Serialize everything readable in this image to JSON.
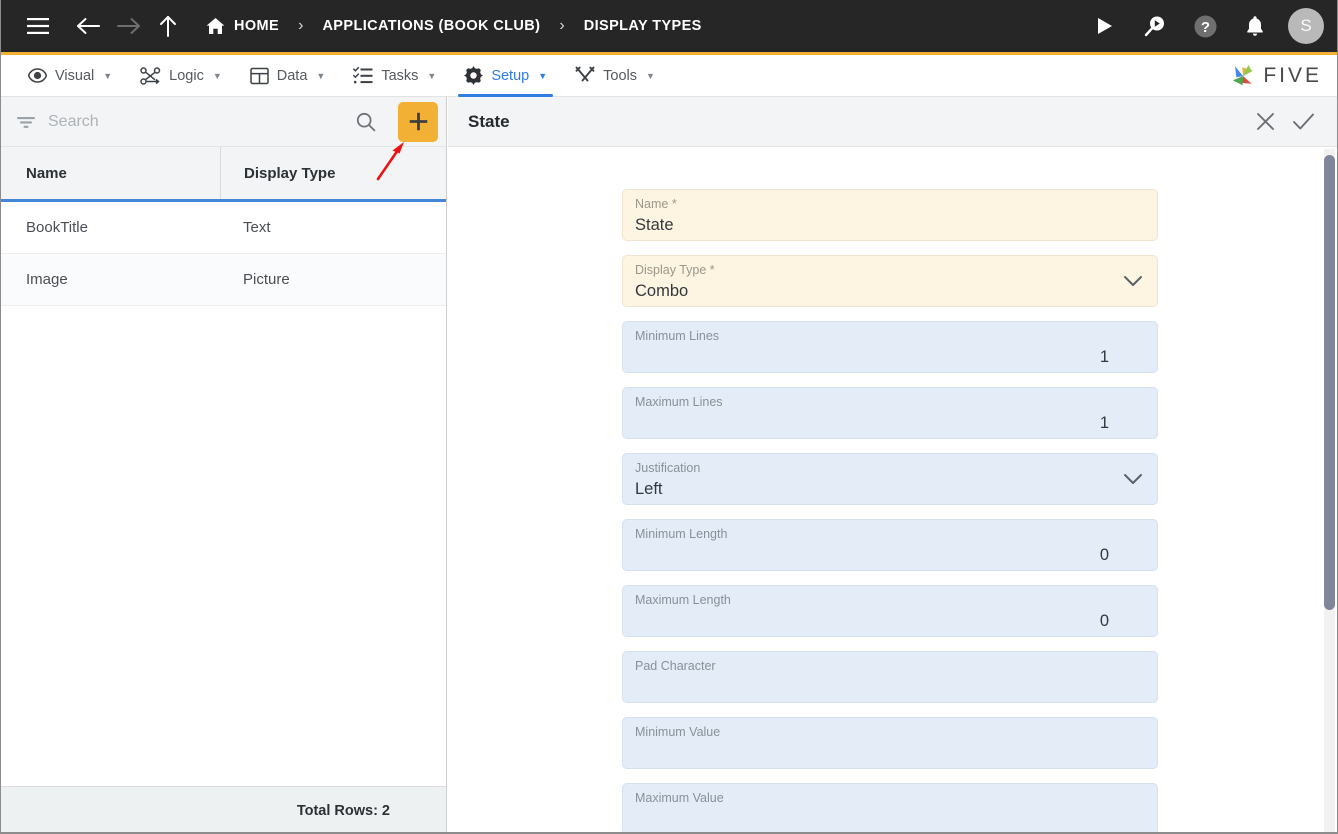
{
  "topbar": {
    "icons": {
      "menu": "hamburger-menu-icon",
      "back": "back-arrow-icon",
      "forward": "forward-arrow-icon",
      "up": "up-arrow-icon"
    },
    "breadcrumbs": [
      {
        "label": "HOME",
        "icon": "home-icon"
      },
      {
        "label": "APPLICATIONS (BOOK CLUB)",
        "icon": ""
      },
      {
        "label": "DISPLAY TYPES",
        "icon": ""
      }
    ],
    "separator": "›",
    "actions": [
      {
        "name": "run-play-button",
        "icon": "play-icon"
      },
      {
        "name": "video-search-button",
        "icon": "video-search-icon"
      },
      {
        "name": "help-button",
        "icon": "help-circle-icon"
      },
      {
        "name": "notifications-button",
        "icon": "bell-icon"
      }
    ],
    "avatar_initial": "S"
  },
  "menubar": {
    "items": [
      {
        "label": "Visual",
        "icon": "eye-icon",
        "active": false
      },
      {
        "label": "Logic",
        "icon": "node-graph-icon",
        "active": false
      },
      {
        "label": "Data",
        "icon": "table-grid-icon",
        "active": false
      },
      {
        "label": "Tasks",
        "icon": "checklist-icon",
        "active": false
      },
      {
        "label": "Setup",
        "icon": "gear-icon",
        "active": true
      },
      {
        "label": "Tools",
        "icon": "wrench-screwdriver-icon",
        "active": false
      }
    ],
    "caret": "▼",
    "logo_text": "FIVE"
  },
  "left_panel": {
    "search": {
      "placeholder": "Search",
      "value": "",
      "filter_icon": "filter-funnel-icon",
      "search_icon": "magnifier-icon"
    },
    "add_button": {
      "label": "+",
      "color": "#F2B134"
    },
    "table": {
      "columns": [
        "Name",
        "Display Type"
      ],
      "rows": [
        {
          "name": "BookTitle",
          "display_type": "Text"
        },
        {
          "name": "Image",
          "display_type": "Picture"
        }
      ]
    },
    "footer": "Total Rows: 2"
  },
  "detail_panel": {
    "title": "State",
    "close_icon": "close-x-icon",
    "confirm_icon": "checkmark-icon",
    "fields": [
      {
        "label": "Name *",
        "value": "State",
        "kind": "required",
        "align": "left",
        "chevron": false
      },
      {
        "label": "Display Type *",
        "value": "Combo",
        "kind": "required",
        "align": "left",
        "chevron": true
      },
      {
        "label": "Minimum Lines",
        "value": "1",
        "kind": "normal",
        "align": "right",
        "chevron": false
      },
      {
        "label": "Maximum Lines",
        "value": "1",
        "kind": "normal",
        "align": "right",
        "chevron": false
      },
      {
        "label": "Justification",
        "value": "Left",
        "kind": "normal",
        "align": "left",
        "chevron": true
      },
      {
        "label": "Minimum Length",
        "value": "0",
        "kind": "normal",
        "align": "right",
        "chevron": false
      },
      {
        "label": "Maximum Length",
        "value": "0",
        "kind": "normal",
        "align": "right",
        "chevron": false
      },
      {
        "label": "Pad Character",
        "value": "",
        "kind": "normal",
        "align": "left",
        "chevron": false
      },
      {
        "label": "Minimum Value",
        "value": "",
        "kind": "normal",
        "align": "left",
        "chevron": false
      },
      {
        "label": "Maximum Value",
        "value": "",
        "kind": "normal",
        "align": "left",
        "chevron": false
      }
    ]
  },
  "annotation": {
    "arrow_color": "#ee1111",
    "description": "red arrow pointing at add button"
  },
  "colors": {
    "accent_yellow": "#F2B134",
    "active_blue": "#2f7de1",
    "topbar_dark": "#262626",
    "required_field": "#fdf5e2",
    "normal_field": "#e3ecf7"
  }
}
